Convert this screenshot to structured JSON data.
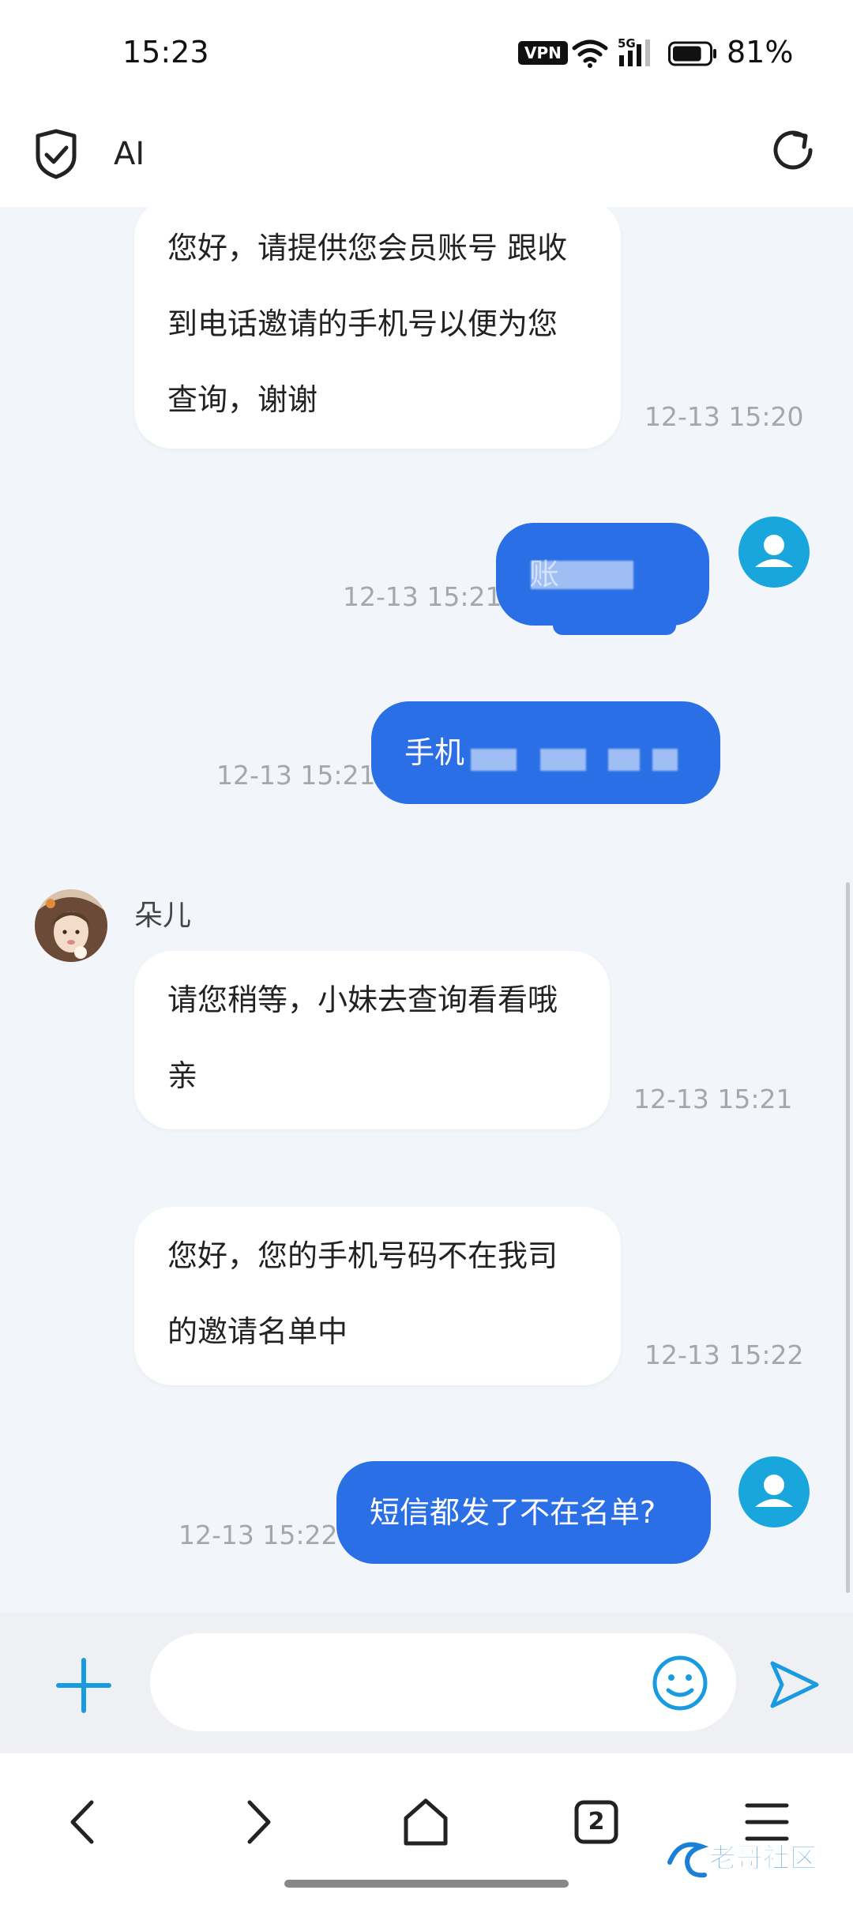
{
  "status_bar": {
    "time": "15:23",
    "vpn": "VPN",
    "network": "5G",
    "battery_percent": "81%",
    "battery_level": 0.81
  },
  "header": {
    "title": "AI",
    "left_icon": "shield-check-icon",
    "right_icon": "refresh-icon"
  },
  "messages": [
    {
      "side": "in",
      "text_lines": [
        "您好，请提供您会员账号 跟收",
        "到电话邀请的手机号以便为您",
        "查询，谢谢"
      ],
      "time": "12-13 15:20"
    },
    {
      "side": "out",
      "text": "账",
      "redacted": true,
      "time": "12-13 15:21"
    },
    {
      "side": "out",
      "text": "手机",
      "redacted": true,
      "time": "12-13 15:21"
    },
    {
      "side": "in",
      "sender": "朵儿",
      "text_lines": [
        "请您稍等，小妹去查询看看哦",
        "亲"
      ],
      "time": "12-13 15:21"
    },
    {
      "side": "in",
      "text_lines": [
        "您好，您的手机号码不在我司",
        "的邀请名单中"
      ],
      "time": "12-13 15:22"
    },
    {
      "side": "out",
      "text": "短信都发了不在名单?",
      "time": "12-13 15:22"
    }
  ],
  "input": {
    "value": "",
    "placeholder": ""
  },
  "nav": {
    "tab_count": "2"
  },
  "watermark": "老哥社区",
  "colors": {
    "accent": "#2a6fe6",
    "avatar": "#18a6dc",
    "chat_bg": "#f2f6fa",
    "icon_blue": "#1a9be0"
  }
}
